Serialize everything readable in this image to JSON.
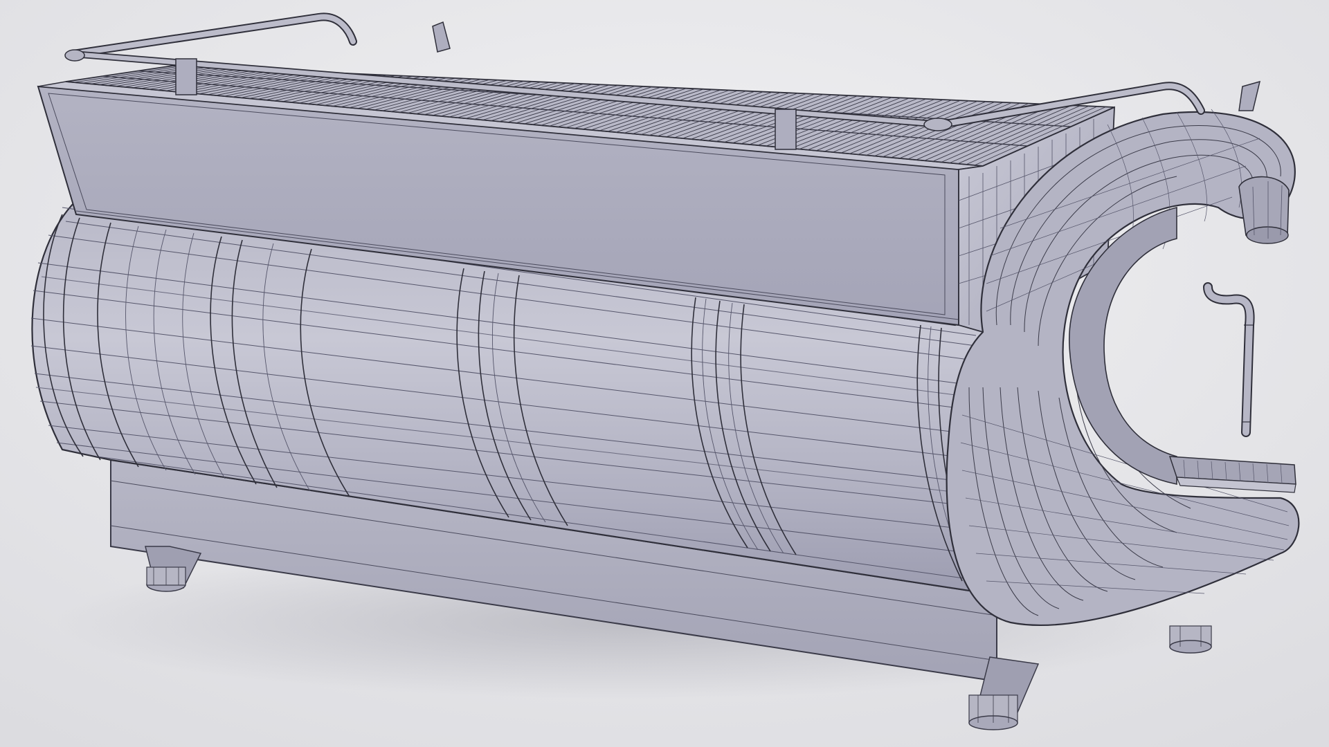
{
  "scene": {
    "subject": "espresso-machine-wireframe-render",
    "colors": {
      "background_light": "#ececee",
      "background_shadow": "#c9c9cf",
      "body_light": "#c2c2d0",
      "body_mid": "#a9a9ba",
      "body_dark": "#8e8ea2",
      "wire": "#2f2f3a",
      "wire_light": "#55556a",
      "metal": "#b4b4c2"
    }
  }
}
